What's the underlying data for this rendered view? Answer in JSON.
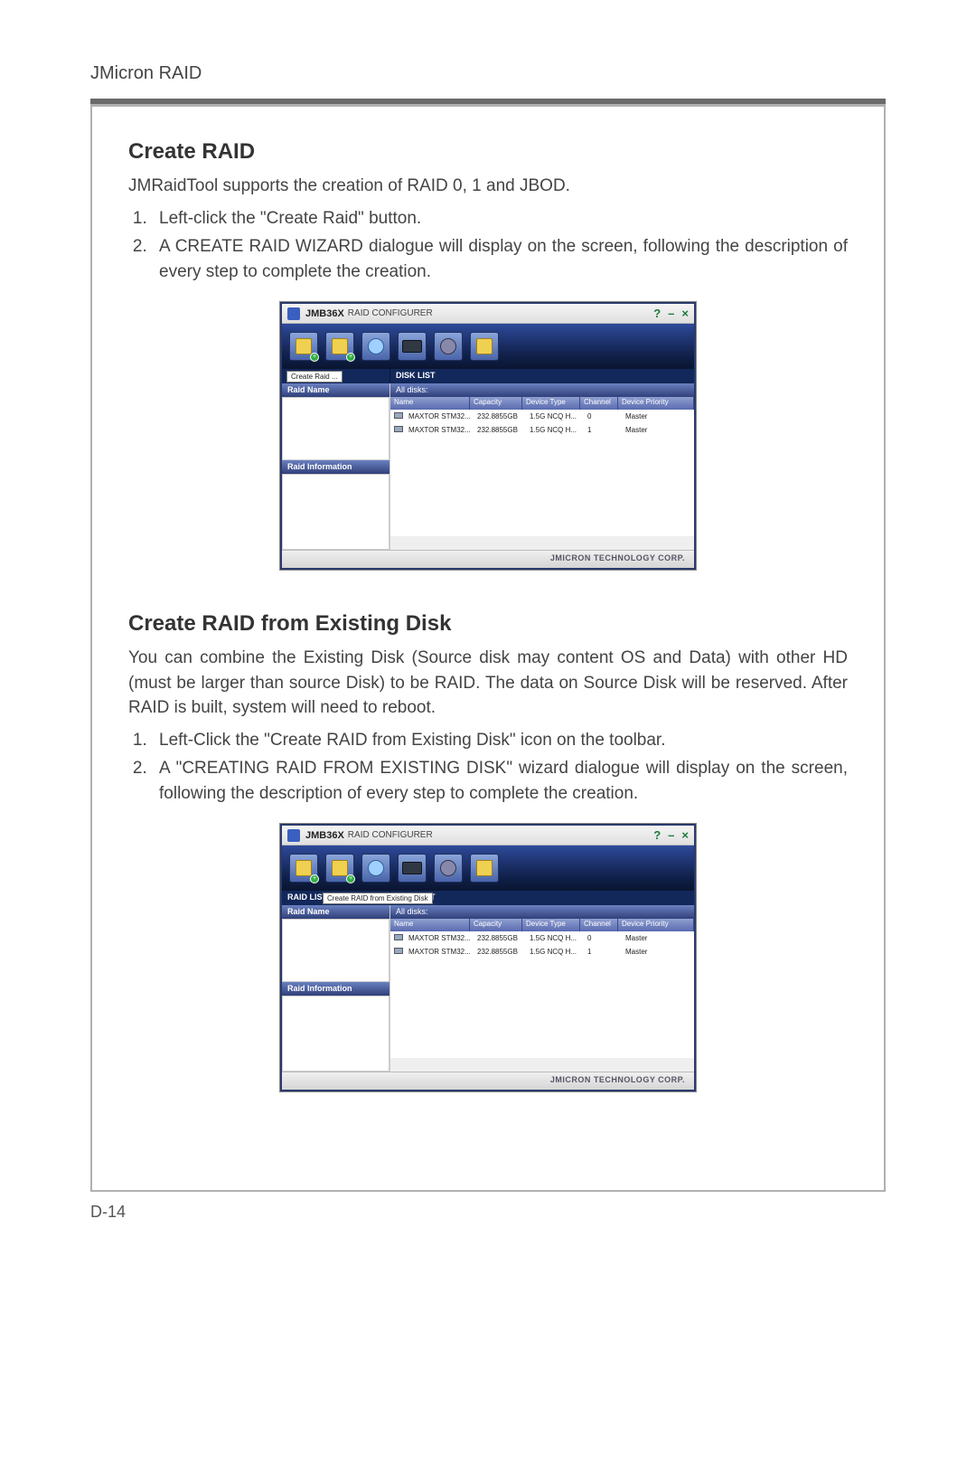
{
  "doc": {
    "header": "JMicron RAID",
    "footer": "D-14"
  },
  "sections": {
    "s1": {
      "title": "Create RAID",
      "intro": "JMRaidTool supports the creation of RAID 0, 1 and JBOD.",
      "step1": "Left-click the \"Create Raid\" button.",
      "step2": "A CREATE RAID WIZARD dialogue will display on the screen, following the description of every step to complete the creation."
    },
    "s2": {
      "title": "Create RAID from Existing Disk",
      "intro": "You can combine the Existing Disk (Source disk may content OS and Data) with other HD (must be larger than source Disk) to be RAID. The data on Source Disk will be reserved. After RAID is built, system will need to reboot.",
      "step1": "Left-Click the \"Create RAID from Existing Disk\" icon on the toolbar.",
      "step2": "A \"CREATING RAID FROM EXISTING DISK\" wizard dialogue will display on the screen, following the description of every step to complete the creation."
    }
  },
  "app": {
    "title_strong": "JMB36X",
    "title_rest": "RAID CONFIGURER",
    "win_help": "?",
    "win_min": "–",
    "win_close": "×",
    "tooltip1": "Create Raid ...",
    "tooltip2": "Create RAID from Existing Disk",
    "raid_list_label": "RAID LIST",
    "disk_list_label": "DISK LIST",
    "raid_name_label": "Raid Name",
    "raid_info_label": "Raid Information",
    "all_disks_label": "All disks:",
    "cols": {
      "name": "Name",
      "capacity": "Capacity",
      "device_type": "Device Type",
      "channel": "Channel",
      "priority": "Device Priority"
    },
    "rows": [
      {
        "name": "MAXTOR STM32...",
        "capacity": "232.8855GB",
        "type": "1.5G NCQ H...",
        "channel": "0",
        "priority": "Master"
      },
      {
        "name": "MAXTOR STM32...",
        "capacity": "232.8855GB",
        "type": "1.5G NCQ H...",
        "channel": "1",
        "priority": "Master"
      }
    ],
    "status": "JMICRON TECHNOLOGY CORP."
  }
}
